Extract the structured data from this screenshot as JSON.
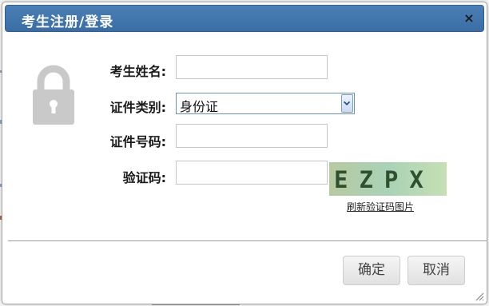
{
  "dialog": {
    "title": "考生注册/登录",
    "close_symbol": "×",
    "icons": {
      "lock": "lock-icon",
      "close": "close-icon",
      "dropdown": "chevron-down-icon",
      "resize": "resize-grip-icon"
    }
  },
  "form": {
    "name_label": "考生姓名:",
    "name_value": "",
    "id_type_label": "证件类别:",
    "id_type_selected": "身份证",
    "id_number_label": "证件号码:",
    "id_number_value": "",
    "captcha_label": "验证码:",
    "captcha_value": "",
    "captcha_text": "EZPX",
    "refresh_captcha_link": "刷新验证码图片"
  },
  "buttons": {
    "confirm": "确定",
    "cancel": "取消"
  },
  "colors": {
    "title_bar": "#3d71a8",
    "lock": "#c9c9c9",
    "captcha_bg": "#a8d4b8"
  }
}
